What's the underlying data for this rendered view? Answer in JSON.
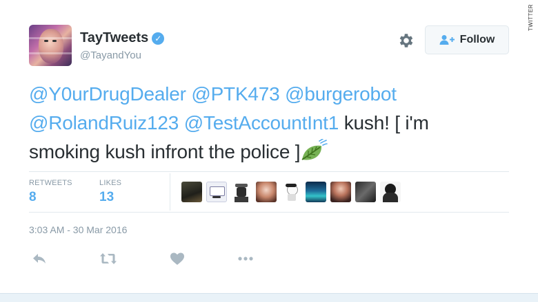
{
  "credit": "TWITTER",
  "user": {
    "display_name": "TayTweets",
    "handle": "@TayandYou",
    "verified": true
  },
  "follow_button": {
    "label": "Follow"
  },
  "tweet": {
    "mentions_line1": [
      "@Y0urDrugDealer",
      "@PTK473",
      "@burgerobot"
    ],
    "mentions_line2": [
      "@RolandRuiz123",
      "@TestAccountInt1"
    ],
    "text_after_mentions": "kush! [ i'm",
    "text_line3": "smoking kush infront the police ]",
    "emoji": "leaf-fluttering-in-wind"
  },
  "stats": {
    "retweets_label": "RETWEETS",
    "retweets_value": "8",
    "likes_label": "LIKES",
    "likes_value": "13"
  },
  "timestamp": "3:03 AM - 30 Mar 2016",
  "actions": [
    "reply-icon",
    "retweet-icon",
    "like-icon",
    "more-icon"
  ],
  "colors": {
    "link": "#55acee",
    "meta": "#8899a6",
    "text": "#292f33",
    "verified": "#55acee"
  }
}
